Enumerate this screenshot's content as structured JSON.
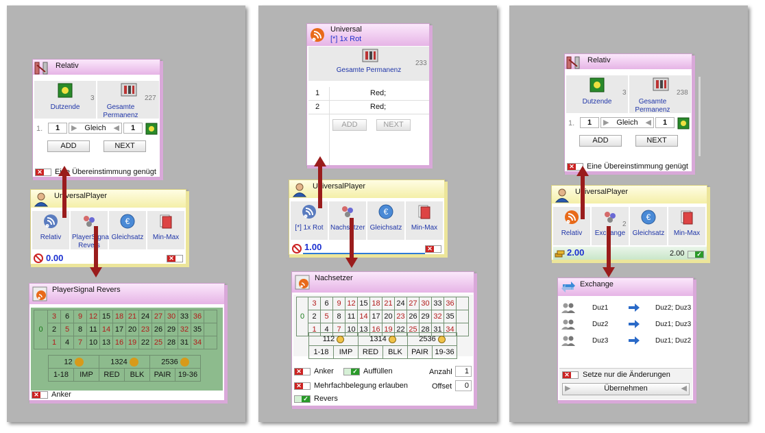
{
  "panel1": {
    "relativ": {
      "title": "Relativ",
      "tile1_caption": "Dutzende",
      "tile1_count": "3",
      "tile2_caption": "Gesamte Permanenz",
      "tile2_count": "227",
      "row_index": "1.",
      "row_value_left": "1",
      "row_op": "Gleich",
      "row_value_right": "1",
      "add_label": "ADD",
      "next_label": "NEXT",
      "checkbox_label": "Eine Übereinstimmung genügt"
    },
    "player": {
      "title": "UniversalPlayer",
      "items": [
        "Relativ",
        "PlayerSignal Revers",
        "Gleichsatz",
        "Min-Max"
      ],
      "amount": "0.00"
    },
    "signal": {
      "title": "PlayerSignal Revers",
      "zero": "0",
      "rows": [
        [
          "3",
          "6",
          "9",
          "12",
          "15",
          "18",
          "21",
          "24",
          "27",
          "30",
          "33",
          "36"
        ],
        [
          "2",
          "5",
          "8",
          "11",
          "14",
          "17",
          "20",
          "23",
          "26",
          "29",
          "32",
          "35"
        ],
        [
          "1",
          "4",
          "7",
          "10",
          "13",
          "16",
          "19",
          "22",
          "25",
          "28",
          "31",
          "34"
        ]
      ],
      "dozens": [
        "12",
        "1324",
        "2536"
      ],
      "bets": [
        "1-18",
        "IMP",
        "RED",
        "BLK",
        "PAIR",
        "19-36"
      ],
      "checkbox_label": "Anker"
    }
  },
  "panel2": {
    "universal": {
      "title": "Universal",
      "subtitle": "[*] 1x Rot",
      "tile_caption": "Gesamte Permanenz",
      "tile_count": "233",
      "rows": [
        {
          "n": "1",
          "v": "Red;"
        },
        {
          "n": "2",
          "v": "Red;"
        }
      ],
      "add_label": "ADD",
      "next_label": "NEXT"
    },
    "player": {
      "title": "UniversalPlayer",
      "items": [
        "[*] 1x Rot",
        "Nachsetzer",
        "Gleichsatz",
        "Min-Max"
      ],
      "amount": "1.00"
    },
    "nachsetzer": {
      "title": "Nachsetzer",
      "zero": "0",
      "rows": [
        [
          "3",
          "6",
          "9",
          "12",
          "15",
          "18",
          "21",
          "24",
          "27",
          "30",
          "33",
          "36"
        ],
        [
          "2",
          "5",
          "8",
          "11",
          "14",
          "17",
          "20",
          "23",
          "26",
          "29",
          "32",
          "35"
        ],
        [
          "1",
          "4",
          "7",
          "10",
          "13",
          "16",
          "19",
          "22",
          "25",
          "28",
          "31",
          "34"
        ]
      ],
      "dozens": [
        "112",
        "1314",
        "2536"
      ],
      "bets": [
        "1-18",
        "IMP",
        "RED",
        "BLK",
        "PAIR",
        "19-36"
      ],
      "anker_label": "Anker",
      "auffuellen_label": "Auffüllen",
      "anzahl_label": "Anzahl",
      "anzahl_value": "1",
      "mehrfach_label": "Mehrfachbelegung erlauben",
      "offset_label": "Offset",
      "offset_value": "0",
      "revers_label": "Revers"
    }
  },
  "panel3": {
    "relativ": {
      "title": "Relativ",
      "tile1_caption": "Dutzende",
      "tile1_count": "3",
      "tile2_caption": "Gesamte Permanenz",
      "tile2_count": "238",
      "row_index": "1.",
      "row_value_left": "1",
      "row_op": "Gleich",
      "row_value_right": "1",
      "add_label": "ADD",
      "next_label": "NEXT",
      "checkbox_label": "Eine Übereinstimmung genügt"
    },
    "player": {
      "title": "UniversalPlayer",
      "items": [
        "Relativ",
        "Exchange",
        "Gleichsatz",
        "Min-Max"
      ],
      "exchange_count": "2",
      "amount": "2.00",
      "amount_right": "2.00"
    },
    "exchange": {
      "title": "Exchange",
      "rows": [
        {
          "from": "Duz1",
          "to": "Duz2; Duz3"
        },
        {
          "from": "Duz2",
          "to": "Duz1; Duz3"
        },
        {
          "from": "Duz3",
          "to": "Duz1; Duz2"
        }
      ],
      "checkbox_label": "Setze nur die Änderungen",
      "apply_label": "Übernehmen"
    }
  },
  "colors": {
    "pink_title": "#e6b4e6",
    "yellow_title": "#f4efa8",
    "table_green": "#8dbb8d",
    "arrow": "#9a1c1c",
    "amount_blue": "#1a2fd0"
  }
}
